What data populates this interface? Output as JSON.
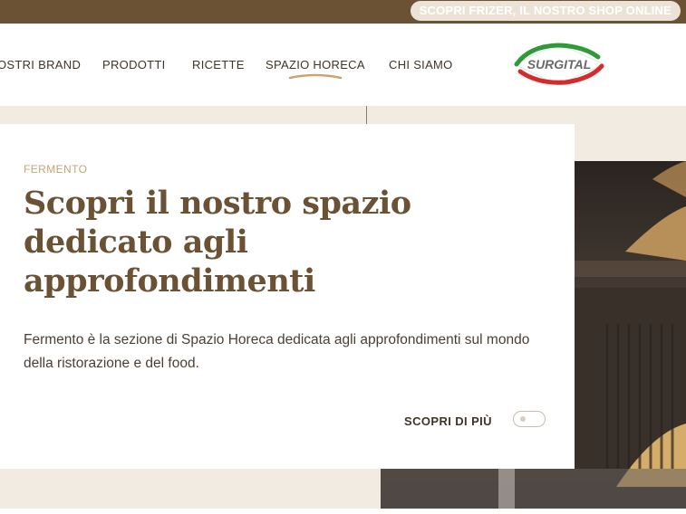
{
  "topbar": {
    "shop_link": "SCOPRI FRIZER, IL NOSTRO SHOP ONLINE"
  },
  "nav": {
    "items": [
      {
        "label": "OSTRI BRAND"
      },
      {
        "label": "PRODOTTI"
      },
      {
        "label": "RICETTE"
      },
      {
        "label": "SPAZIO HORECA"
      },
      {
        "label": "CHI SIAMO"
      }
    ],
    "logo_text": "SURGITAL"
  },
  "hero": {
    "eyebrow": "FERMENTO",
    "headline": "Scopri il nostro spazio dedicato agli approfondimenti",
    "description": "Fermento è la sezione di Spazio Horeca dedicata agli approfondimenti sul mondo della ristorazione e del food.",
    "cta_label": "SCOPRI DI PIÙ"
  },
  "colors": {
    "brand_brown": "#6b5234",
    "accent_tan": "#c9a27a",
    "hero_background": "#f2ebe2",
    "logo_green": "#2e9a3a",
    "logo_red": "#d62b2b"
  }
}
